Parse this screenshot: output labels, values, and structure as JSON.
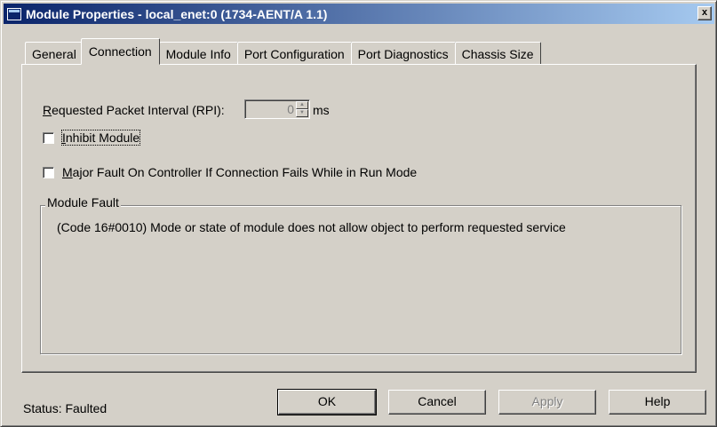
{
  "window": {
    "title": "Module Properties - local_enet:0 (1734-AENT/A 1.1)",
    "close_label": "x"
  },
  "tabs": [
    {
      "label": "General",
      "active": false
    },
    {
      "label": "Connection",
      "active": true
    },
    {
      "label": "Module Info",
      "active": false
    },
    {
      "label": "Port Configuration",
      "active": false
    },
    {
      "label": "Port Diagnostics",
      "active": false
    },
    {
      "label": "Chassis Size",
      "active": false
    }
  ],
  "connection": {
    "rpi_label_mnemonic": "R",
    "rpi_label_rest": "equested Packet Interval (RPI):",
    "rpi_value": "0",
    "rpi_unit": "ms",
    "inhibit_mnemonic": "I",
    "inhibit_rest": "nhibit Module",
    "inhibit_checked": false,
    "major_fault_mnemonic": "M",
    "major_fault_rest": "ajor Fault On Controller If Connection Fails While in Run Mode",
    "major_fault_checked": false
  },
  "module_fault": {
    "title": "Module Fault",
    "message": "(Code 16#0010) Mode or state of module does not allow object to perform requested service"
  },
  "status": {
    "text": "Status:  Faulted"
  },
  "buttons": {
    "ok": "OK",
    "cancel": "Cancel",
    "apply": "Apply",
    "help": "Help"
  }
}
